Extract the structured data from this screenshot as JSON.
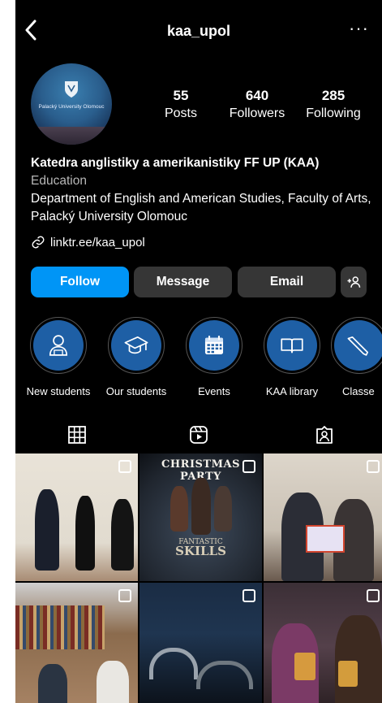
{
  "header": {
    "username": "kaa_upol",
    "more_label": "···"
  },
  "avatar": {
    "text": "Palacký University Olomouc"
  },
  "stats": [
    {
      "value": "55",
      "label": "Posts"
    },
    {
      "value": "640",
      "label": "Followers"
    },
    {
      "value": "285",
      "label": "Following"
    }
  ],
  "bio": {
    "name": "Katedra anglistiky a amerikanistiky FF UP (KAA)",
    "category": "Education",
    "description": "Department of English and American Studies, Faculty of Arts, Palacký University Olomouc",
    "link": "linktr.ee/kaa_upol"
  },
  "actions": {
    "follow": "Follow",
    "message": "Message",
    "email": "Email"
  },
  "highlights": [
    {
      "label": "New students",
      "icon": "student-icon"
    },
    {
      "label": "Our students",
      "icon": "graduation-cap-icon"
    },
    {
      "label": "Events",
      "icon": "calendar-icon"
    },
    {
      "label": "KAA library",
      "icon": "book-icon"
    },
    {
      "label": "Classe",
      "icon": "pencil-icon"
    }
  ],
  "posts": {
    "post2_title": "CHRISTMAS PARTY",
    "post2_movie_line1": "FANTASTIC",
    "post2_movie_line2": "SKILLS"
  },
  "colors": {
    "accent": "#0095f6",
    "button": "#363636",
    "highlight": "#1e5fa5"
  }
}
